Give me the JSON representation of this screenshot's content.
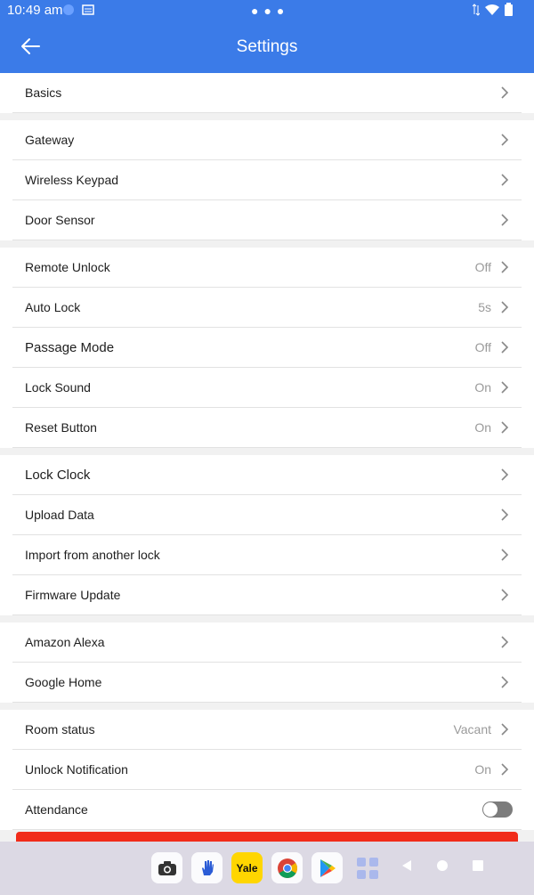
{
  "status_bar": {
    "time": "10:49 am"
  },
  "app_bar": {
    "title": "Settings"
  },
  "groups": [
    [
      {
        "label": "Basics",
        "value": ""
      }
    ],
    [
      {
        "label": "Gateway",
        "value": ""
      },
      {
        "label": "Wireless Keypad",
        "value": ""
      },
      {
        "label": "Door Sensor",
        "value": ""
      }
    ],
    [
      {
        "label": "Remote Unlock",
        "value": "Off"
      },
      {
        "label": "Auto Lock",
        "value": "5s"
      },
      {
        "label": "Passage Mode",
        "value": "Off"
      },
      {
        "label": "Lock Sound",
        "value": "On"
      },
      {
        "label": "Reset Button",
        "value": "On"
      }
    ],
    [
      {
        "label": "Lock Clock",
        "value": ""
      },
      {
        "label": "Upload Data",
        "value": ""
      },
      {
        "label": "Import from another lock",
        "value": ""
      },
      {
        "label": "Firmware Update",
        "value": ""
      }
    ],
    [
      {
        "label": "Amazon Alexa",
        "value": ""
      },
      {
        "label": "Google Home",
        "value": ""
      }
    ],
    [
      {
        "label": "Room status",
        "value": "Vacant"
      },
      {
        "label": "Unlock Notification",
        "value": "On"
      },
      {
        "label": "Attendance",
        "value": "",
        "toggle": false
      }
    ]
  ],
  "dock": {
    "yale_label": "Yale",
    "icons": [
      "camera-icon",
      "hand-icon",
      "yale-icon",
      "chrome-icon",
      "play-store-icon",
      "app-grid-icon"
    ]
  },
  "colors": {
    "accent": "#3b7be8",
    "danger": "#f12b19"
  }
}
